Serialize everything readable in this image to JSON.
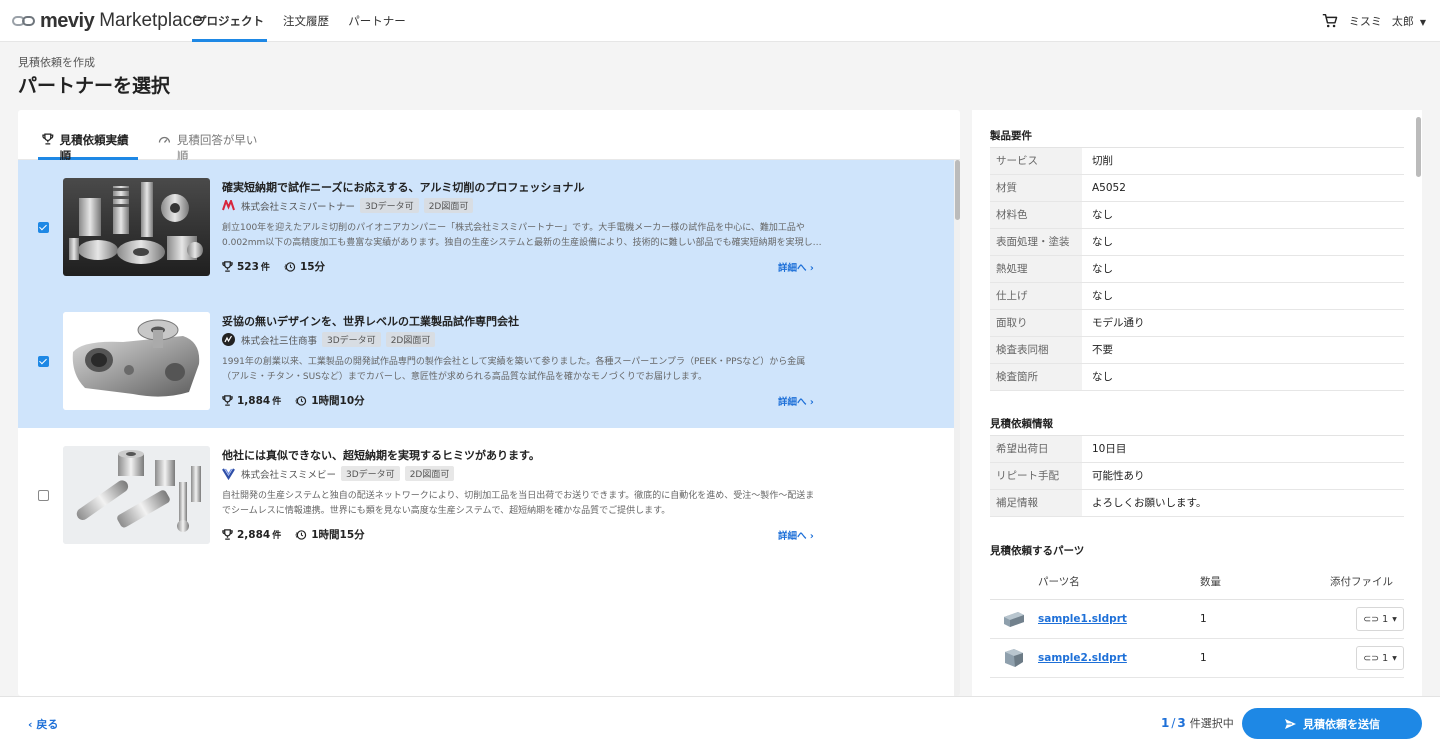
{
  "header": {
    "brand": "meviy",
    "brand_sub": "Marketplace",
    "nav": [
      "プロジェクト",
      "注文履歴",
      "パートナー"
    ],
    "active_nav": "プロジェクト",
    "user_company": "ミスミ",
    "user_name": "太郎"
  },
  "page": {
    "breadcrumb": "見積依頼を作成",
    "title": "パートナーを選択"
  },
  "sort_tabs": [
    "見積依頼実績順",
    "見積回答が早い順"
  ],
  "partners": [
    {
      "selected": true,
      "title": "確実短納期で試作ニーズにお応えする、アルミ切削のプロフェッショナル",
      "company": "株式会社ミスミパートナー",
      "tags": [
        "3Dデータ可",
        "2D図面可"
      ],
      "description": "創立100年を迎えたアルミ切削のパイオニアカンパニー「株式会社ミスミパートナー」です。大手電機メーカー様の試作品を中心に、難加工品や0.002mm以下の高精度加工も豊富な実績があります。独自の生産システムと最新の生産設備により、技術的に難しい部品でも確実短納期を実現し…",
      "orders": "523",
      "orders_unit": "件",
      "response_time": "15分",
      "detail": "詳細へ"
    },
    {
      "selected": true,
      "title": "妥協の無いデザインを、世界レベルの工業製品試作専門会社",
      "company": "株式会社三住商事",
      "tags": [
        "3Dデータ可",
        "2D図面可"
      ],
      "description": "1991年の創業以来、工業製品の開発試作品専門の製作会社として実績を築いて参りました。各種スーパーエンプラ（PEEK・PPSなど）から金属（アルミ・チタン・SUSなど）までカバーし、意匠性が求められる高品質な試作品を確かなモノづくりでお届けします。",
      "orders": "1,884",
      "orders_unit": "件",
      "response_time": "1時間10分",
      "detail": "詳細へ"
    },
    {
      "selected": false,
      "title": "他社には真似できない、超短納期を実現するヒミツがあります。",
      "company": "株式会社ミスミメビー",
      "tags": [
        "3Dデータ可",
        "2D図面可"
      ],
      "description": "自社開発の生産システムと独自の配送ネットワークにより、切削加工品を当日出荷でお送りできます。徹底的に自動化を進め、受注～製作～配送までシームレスに情報連携。世界にも類を見ない高度な生産システムで、超短納期を確かな品質でご提供します。",
      "orders": "2,884",
      "orders_unit": "件",
      "response_time": "1時間15分",
      "detail": "詳細へ"
    }
  ],
  "product_requirements": {
    "title": "製品要件",
    "rows": [
      {
        "key": "サービス",
        "value": "切削"
      },
      {
        "key": "材質",
        "value": "A5052"
      },
      {
        "key": "材料色",
        "value": "なし"
      },
      {
        "key": "表面処理・塗装",
        "value": "なし"
      },
      {
        "key": "熱処理",
        "value": "なし"
      },
      {
        "key": "仕上げ",
        "value": "なし"
      },
      {
        "key": "面取り",
        "value": "モデル通り"
      },
      {
        "key": "検査表同梱",
        "value": "不要"
      },
      {
        "key": "検査箇所",
        "value": "なし"
      }
    ]
  },
  "quote_info": {
    "title": "見積依頼情報",
    "rows": [
      {
        "key": "希望出荷日",
        "value": "10日目"
      },
      {
        "key": "リピート手配",
        "value": "可能性あり"
      },
      {
        "key": "補足情報",
        "value": "よろしくお願いします。"
      }
    ]
  },
  "parts": {
    "title": "見積依頼するパーツ",
    "headers": [
      "パーツ名",
      "数量",
      "添付ファイル"
    ],
    "rows": [
      {
        "name": "sample1.sldprt",
        "qty": "1",
        "files": "1"
      },
      {
        "name": "sample2.sldprt",
        "qty": "1",
        "files": "1"
      }
    ]
  },
  "footer": {
    "back": "戻る",
    "selected_count": "1",
    "total_count": "3",
    "selected_suffix": "件選択中",
    "send": "見積依頼を送信"
  },
  "colors": {
    "accent": "#1e88e5",
    "link": "#1e70d8",
    "selected_row": "#cfe4fb"
  }
}
